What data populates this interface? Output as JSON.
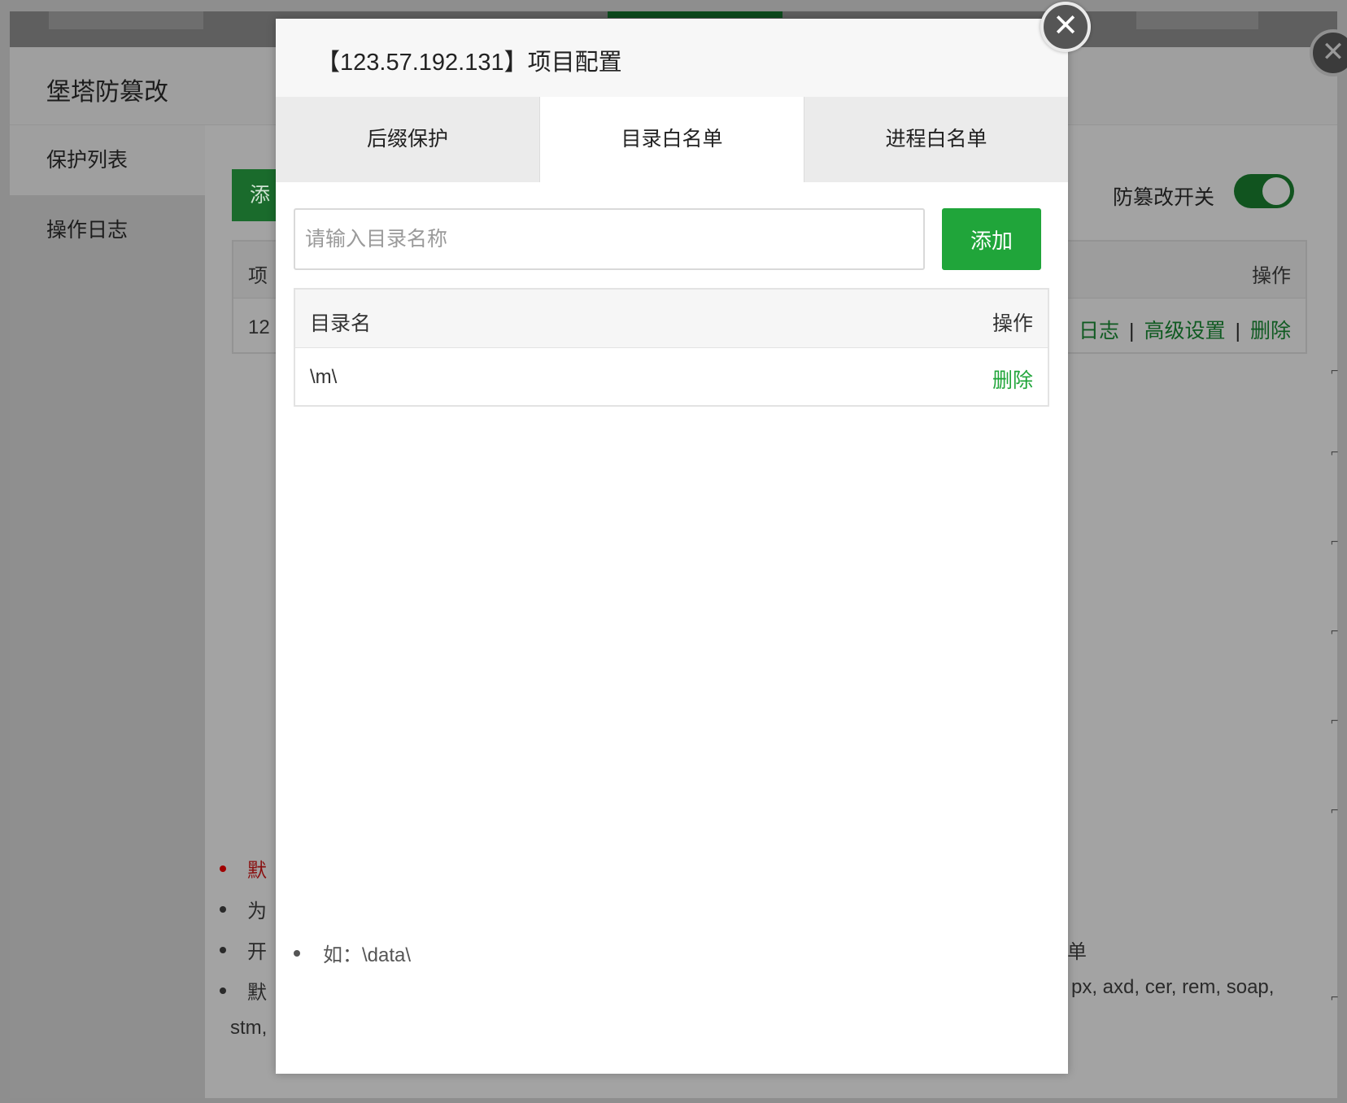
{
  "background": {
    "plugin_title": "堡塔防篡改",
    "sidebar": [
      {
        "label": "保护列表",
        "active": true
      },
      {
        "label": "操作日志",
        "active": false
      }
    ],
    "add_button_fragment": "添",
    "switch_label": "防篡改开关",
    "switch_on": true,
    "table": {
      "col_fragment": "项",
      "op_header": "操作",
      "row_fragment": "12",
      "links": [
        "日志",
        "高级设置",
        "删除"
      ]
    },
    "notes": {
      "n1": "默",
      "n2": "为",
      "n3_left": "开",
      "n3_right": "单",
      "n4_left": "默",
      "n4_right": "px, axd, cer, rem, soap,",
      "n5": "stm,"
    }
  },
  "modal": {
    "title": "【123.57.192.131】项目配置",
    "tabs": [
      {
        "label": "后缀保护",
        "active": false
      },
      {
        "label": "目录白名单",
        "active": true
      },
      {
        "label": "进程白名单",
        "active": false
      }
    ],
    "input": {
      "placeholder": "请输入目录名称",
      "value": ""
    },
    "add_label": "添加",
    "table": {
      "headers": {
        "name": "目录名",
        "op": "操作"
      },
      "rows": [
        {
          "name": "\\m\\",
          "op": "删除"
        }
      ]
    },
    "hint": "如：\\data\\"
  },
  "colors": {
    "accent": "#20a53a",
    "overlay_bg": "#a3a3a3"
  },
  "icons": {
    "close": "close-icon"
  }
}
